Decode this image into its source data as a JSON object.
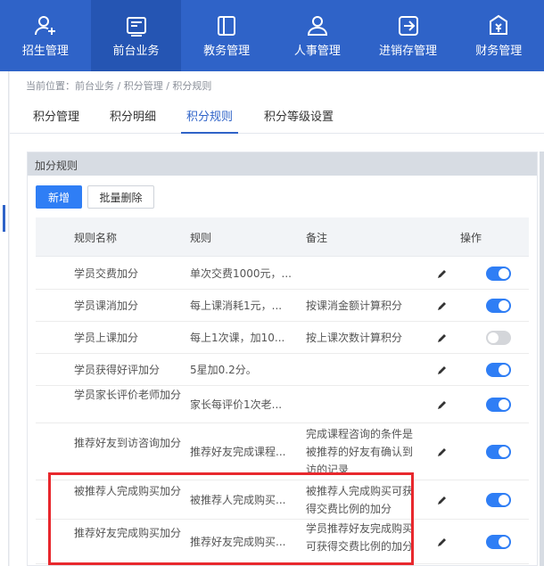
{
  "nav": {
    "items": [
      {
        "label": "招生管理",
        "icon": "add-user-icon"
      },
      {
        "label": "前台业务",
        "icon": "reception-icon"
      },
      {
        "label": "教务管理",
        "icon": "book-icon"
      },
      {
        "label": "人事管理",
        "icon": "user-icon"
      },
      {
        "label": "进销存管理",
        "icon": "inventory-icon"
      },
      {
        "label": "财务管理",
        "icon": "finance-icon"
      }
    ]
  },
  "breadcrumb": "当前位置：前台业务 / 积分管理 / 积分规则",
  "tabs": [
    {
      "label": "积分管理"
    },
    {
      "label": "积分明细"
    },
    {
      "label": "积分规则"
    },
    {
      "label": "积分等级设置"
    }
  ],
  "panel": {
    "title": "加分规则",
    "add_label": "新增",
    "batch_delete_label": "批量删除"
  },
  "table": {
    "headers": {
      "name": "规则名称",
      "rule": "规则",
      "remark": "备注",
      "action": "操作"
    },
    "rows": [
      {
        "name": "学员交费加分",
        "rule": "单次交费1000元，...",
        "remark": "",
        "enabled": true
      },
      {
        "name": "学员课消加分",
        "rule": "每上课消耗1元，...",
        "remark": "按课消金额计算积分",
        "enabled": true
      },
      {
        "name": "学员上课加分",
        "rule": "每上1次课，加10...",
        "remark": "按上课次数计算积分",
        "enabled": false
      },
      {
        "name": "学员获得好评加分",
        "rule": "5星加0.2分。",
        "remark": "",
        "enabled": true
      },
      {
        "name": "学员家长评价老师加分",
        "rule": "家长每评价1次老...",
        "remark": "",
        "enabled": true
      },
      {
        "name": "推荐好友到访咨询加分",
        "rule": "推荐好友完成课程...",
        "remark": "完成课程咨询的条件是被推荐的好友有确认到访的记录",
        "enabled": true
      },
      {
        "name": "被推荐人完成购买加分",
        "rule": "被推荐人完成购买...",
        "remark": "被推荐人完成购买可获得交费比例的加分",
        "enabled": true
      },
      {
        "name": "推荐好友完成购买加分",
        "rule": "推荐好友完成购买...",
        "remark": "学员推荐好友完成购买可获得交费比例的加分",
        "enabled": true
      }
    ]
  },
  "colors": {
    "primary": "#2f63c8",
    "accent": "#2f7ef5",
    "highlight": "#e8282d"
  }
}
